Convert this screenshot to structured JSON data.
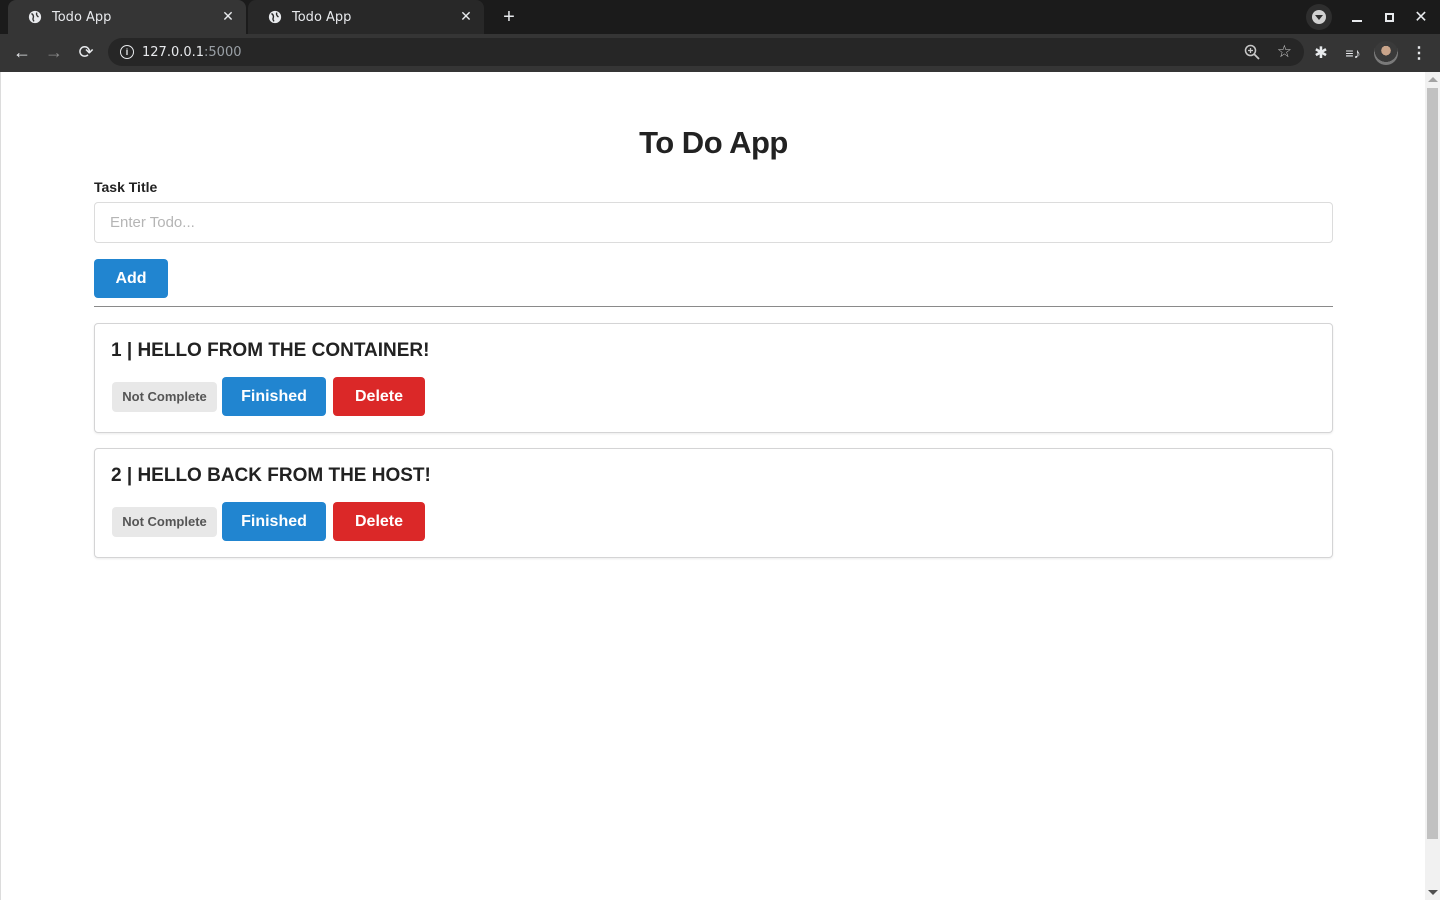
{
  "browser": {
    "tabs": [
      {
        "title": "Todo App",
        "active": true,
        "close": "✕"
      },
      {
        "title": "Todo App",
        "active": false,
        "close": "✕"
      }
    ],
    "new_tab": "+",
    "url_host": "127.0.0.1",
    "url_port": ":5000",
    "icons": {
      "back": "←",
      "forward": "→",
      "reload": "⟳",
      "info": "i",
      "star": "☆",
      "extensions": "✱",
      "media": "≡♪",
      "menu": "⋮",
      "close_window": "✕"
    }
  },
  "app": {
    "title": "To Do App",
    "form": {
      "label": "Task Title",
      "placeholder": "Enter Todo...",
      "value": "",
      "add_label": "Add"
    },
    "todos": [
      {
        "id": 1,
        "heading": "1 | HELLO FROM THE CONTAINER!",
        "status": "Not Complete",
        "finish_label": "Finished",
        "delete_label": "Delete"
      },
      {
        "id": 2,
        "heading": "2 | HELLO BACK FROM THE HOST!",
        "status": "Not Complete",
        "finish_label": "Finished",
        "delete_label": "Delete"
      }
    ]
  },
  "colors": {
    "primary": "#2185d0",
    "danger": "#db2828",
    "status_bg": "#e8e8e8"
  }
}
